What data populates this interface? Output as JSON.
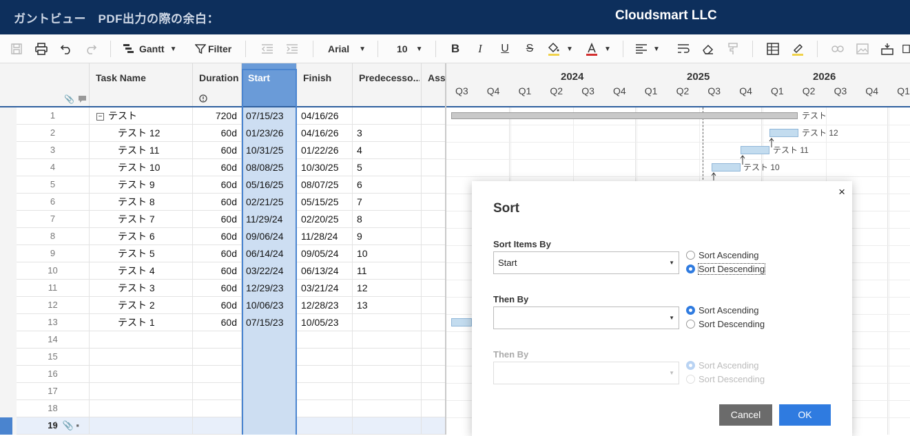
{
  "header": {
    "title": "ガントビュー　PDF出力の際の余白：",
    "brand": "Cloudsmart LLC"
  },
  "toolbar": {
    "view": "Gantt",
    "filter": "Filter",
    "font": "Arial",
    "size": "10"
  },
  "columns": {
    "task_name": "Task Name",
    "duration": "Duration",
    "start": "Start",
    "finish": "Finish",
    "predecessors": "Predecesso...",
    "assigned": "Assi"
  },
  "rows": [
    {
      "n": "1",
      "name": "テスト",
      "dur": "720d",
      "start": "07/15/23",
      "finish": "04/16/26",
      "pred": ""
    },
    {
      "n": "2",
      "name": "テスト 12",
      "dur": "60d",
      "start": "01/23/26",
      "finish": "04/16/26",
      "pred": "3"
    },
    {
      "n": "3",
      "name": "テスト 11",
      "dur": "60d",
      "start": "10/31/25",
      "finish": "01/22/26",
      "pred": "4"
    },
    {
      "n": "4",
      "name": "テスト 10",
      "dur": "60d",
      "start": "08/08/25",
      "finish": "10/30/25",
      "pred": "5"
    },
    {
      "n": "5",
      "name": "テスト 9",
      "dur": "60d",
      "start": "05/16/25",
      "finish": "08/07/25",
      "pred": "6"
    },
    {
      "n": "6",
      "name": "テスト 8",
      "dur": "60d",
      "start": "02/21/25",
      "finish": "05/15/25",
      "pred": "7"
    },
    {
      "n": "7",
      "name": "テスト 7",
      "dur": "60d",
      "start": "11/29/24",
      "finish": "02/20/25",
      "pred": "8"
    },
    {
      "n": "8",
      "name": "テスト 6",
      "dur": "60d",
      "start": "09/06/24",
      "finish": "11/28/24",
      "pred": "9"
    },
    {
      "n": "9",
      "name": "テスト 5",
      "dur": "60d",
      "start": "06/14/24",
      "finish": "09/05/24",
      "pred": "10"
    },
    {
      "n": "10",
      "name": "テスト 4",
      "dur": "60d",
      "start": "03/22/24",
      "finish": "06/13/24",
      "pred": "11"
    },
    {
      "n": "11",
      "name": "テスト 3",
      "dur": "60d",
      "start": "12/29/23",
      "finish": "03/21/24",
      "pred": "12"
    },
    {
      "n": "12",
      "name": "テスト 2",
      "dur": "60d",
      "start": "10/06/23",
      "finish": "12/28/23",
      "pred": "13"
    },
    {
      "n": "13",
      "name": "テスト 1",
      "dur": "60d",
      "start": "07/15/23",
      "finish": "10/05/23",
      "pred": ""
    },
    {
      "n": "14",
      "name": "",
      "dur": "",
      "start": "",
      "finish": "",
      "pred": ""
    },
    {
      "n": "15",
      "name": "",
      "dur": "",
      "start": "",
      "finish": "",
      "pred": ""
    },
    {
      "n": "16",
      "name": "",
      "dur": "",
      "start": "",
      "finish": "",
      "pred": ""
    },
    {
      "n": "17",
      "name": "",
      "dur": "",
      "start": "",
      "finish": "",
      "pred": ""
    },
    {
      "n": "18",
      "name": "",
      "dur": "",
      "start": "",
      "finish": "",
      "pred": ""
    },
    {
      "n": "19",
      "name": "",
      "dur": "",
      "start": "",
      "finish": "",
      "pred": ""
    }
  ],
  "gantt": {
    "years": [
      "2024",
      "2025",
      "2026"
    ],
    "quarters": [
      "Q3",
      "Q4",
      "Q1",
      "Q2",
      "Q3",
      "Q4",
      "Q1",
      "Q2",
      "Q3",
      "Q4",
      "Q1",
      "Q2",
      "Q3",
      "Q4",
      "Q1"
    ],
    "bar_labels": [
      "テスト",
      "テスト 12",
      "テスト 11",
      "テスト 10"
    ]
  },
  "sort_dialog": {
    "title": "Sort",
    "close": "×",
    "sort_items_by": "Sort Items By",
    "then_by_1": "Then By",
    "then_by_2": "Then By",
    "field_1": "Start",
    "field_2": "",
    "field_3": "",
    "ascending": "Sort Ascending",
    "descending": "Sort Descending",
    "cancel": "Cancel",
    "ok": "OK"
  },
  "colors": {
    "header_bg": "#0d2f5c",
    "accent": "#2f7be0",
    "selected_col": "#6a9bd8"
  }
}
